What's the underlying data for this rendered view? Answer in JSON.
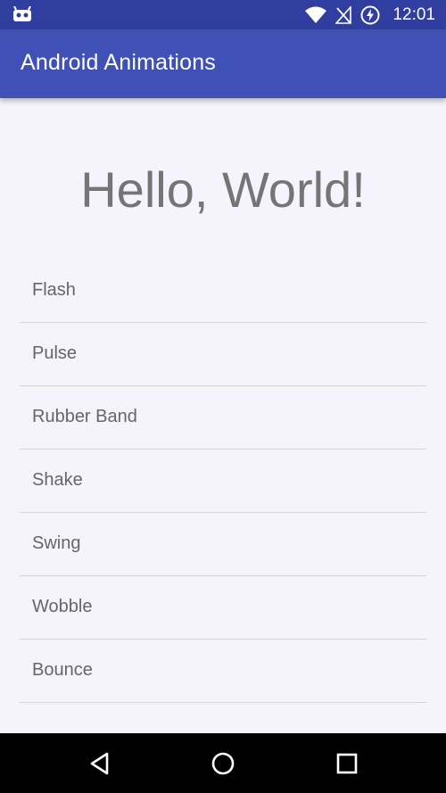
{
  "status_bar": {
    "time": "12:01",
    "icons": [
      "android-debug-icon",
      "wifi-icon",
      "no-signal-icon",
      "battery-charging-icon"
    ]
  },
  "app_bar": {
    "title": "Android Animations",
    "background": "#3f51b5",
    "status_background": "#303f9f"
  },
  "main": {
    "heading": "Hello, World!"
  },
  "animations": [
    {
      "label": "Flash"
    },
    {
      "label": "Pulse"
    },
    {
      "label": "Rubber Band"
    },
    {
      "label": "Shake"
    },
    {
      "label": "Swing"
    },
    {
      "label": "Wobble"
    },
    {
      "label": "Bounce"
    }
  ],
  "nav_bar": {
    "buttons": [
      "back-icon",
      "home-icon",
      "recents-icon"
    ]
  }
}
